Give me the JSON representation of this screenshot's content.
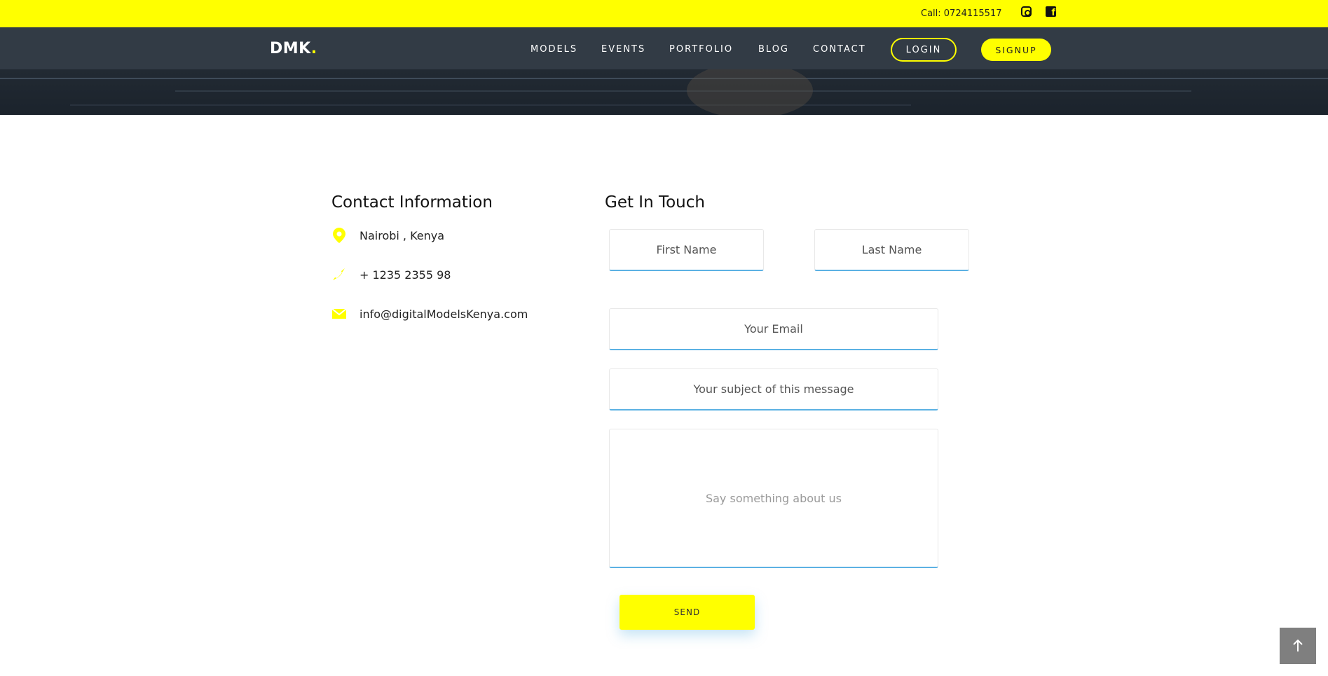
{
  "topbar": {
    "call_text": "Call: 0724115517",
    "social": [
      "instagram-icon",
      "facebook-icon"
    ]
  },
  "navbar": {
    "logo": "DMK",
    "logo_dot": ".",
    "links": [
      "MODELS",
      "EVENTS",
      "PORTFOLIO",
      "BLOG",
      "CONTACT"
    ],
    "login_label": "LOGIN",
    "signup_label": "SIGNUP"
  },
  "contact_info": {
    "heading": "Contact Information",
    "items": [
      {
        "icon": "location-pin-icon",
        "text": "Nairobi , Kenya"
      },
      {
        "icon": "phone-icon",
        "text": "+ 1235 2355 98"
      },
      {
        "icon": "mail-icon",
        "text": "info@digitalModelsKenya.com"
      }
    ]
  },
  "form": {
    "heading": "Get In Touch",
    "first_name": "First Name",
    "last_name": "Last Name",
    "email": "Your Email",
    "subject": "Your subject of this message",
    "message_placeholder": "Say something about us",
    "send_label": "SEND"
  },
  "colors": {
    "accent": "#ffff00",
    "nav_bg": "#323b45",
    "input_underline": "#5cb1e3"
  },
  "scroll_top_icon": "arrow-up-icon"
}
